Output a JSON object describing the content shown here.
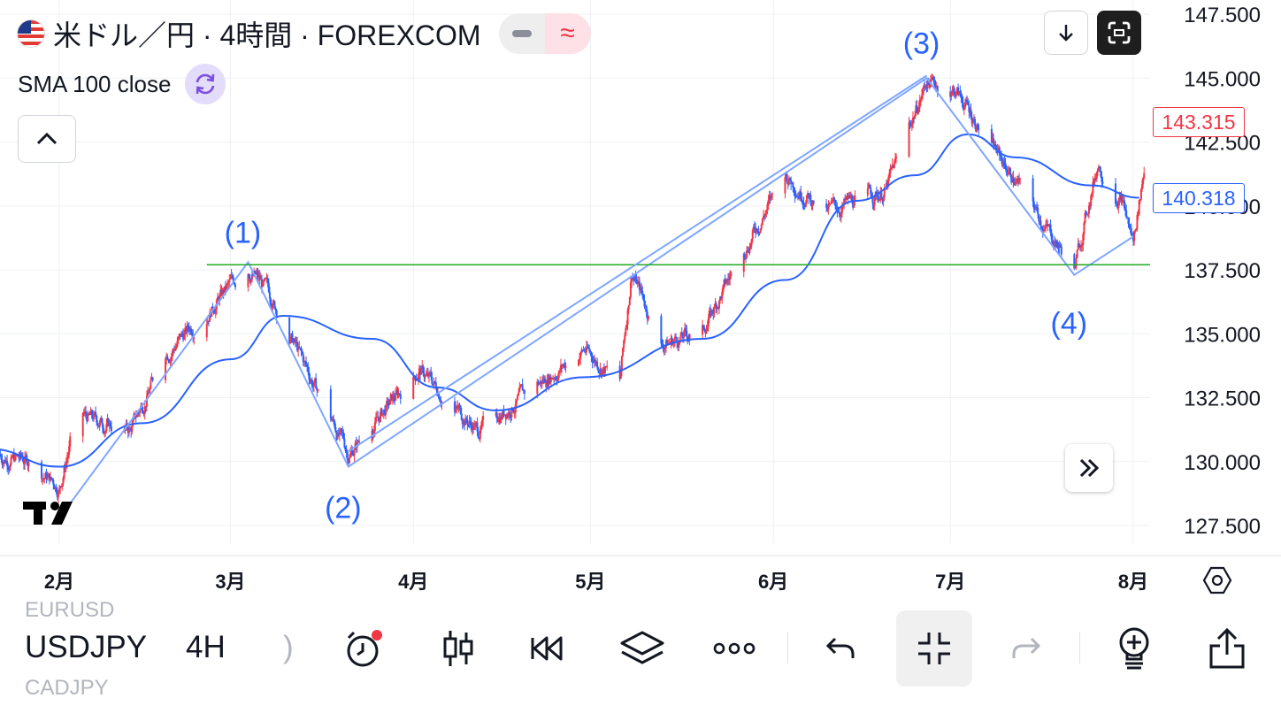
{
  "header": {
    "symbol_title": "米ドル／円 · 4時間 · FOREXCOM",
    "indicator_label": "SMA 100 close"
  },
  "price_tags": {
    "last_price": "143.315",
    "sma_value": "140.318"
  },
  "colors": {
    "up": "#f23645",
    "down": "#2962ff",
    "sma": "#2962ff",
    "trendline": "#7fa6ff",
    "level": "#22ab22",
    "wave_label": "#2962ff",
    "grid": "#eef0f3"
  },
  "icons": {
    "flag": "us-japan-flag-icon",
    "minus": "minus-icon",
    "approx": "approx-icon",
    "sync": "sync-icon",
    "collapse": "chevron-up-icon",
    "down": "arrow-down-icon",
    "fullscreen": "fullscreen-icon",
    "forward": "double-chevron-right-icon",
    "settings": "settings-hexagon-icon"
  },
  "approx_glyph": "≈",
  "chart_data": {
    "type": "candlestick",
    "y_ticks": [
      "147.500",
      "145.000",
      "142.500",
      "140.000",
      "137.500",
      "135.000",
      "132.500",
      "130.000",
      "127.500"
    ],
    "x_ticks": [
      "2月",
      "3月",
      "4月",
      "5月",
      "6月",
      "7月",
      "8月"
    ],
    "ylim": [
      126.5,
      147.9
    ],
    "wave_labels": [
      "(1)",
      "(2)",
      "(3)",
      "(4)"
    ],
    "pivots": [
      {
        "x": "2024-02-02",
        "y": 128.1
      },
      {
        "x": "2024-03-04",
        "y": 137.8
      },
      {
        "x": "2024-03-21",
        "y": 129.8
      },
      {
        "x": "2024-06-27",
        "y": 145.0
      },
      {
        "x": "2024-07-22",
        "y": 137.3
      },
      {
        "x": "2024-08-01",
        "y": 138.8
      }
    ],
    "horizontal_level": 137.7,
    "sma_path": [
      {
        "x": "2024-01-20",
        "y": 130.5
      },
      {
        "x": "2024-02-01",
        "y": 129.8
      },
      {
        "x": "2024-02-15",
        "y": 131.5
      },
      {
        "x": "2024-03-01",
        "y": 134.0
      },
      {
        "x": "2024-03-10",
        "y": 135.7
      },
      {
        "x": "2024-03-25",
        "y": 134.8
      },
      {
        "x": "2024-04-05",
        "y": 132.9
      },
      {
        "x": "2024-04-15",
        "y": 132.0
      },
      {
        "x": "2024-04-30",
        "y": 133.3
      },
      {
        "x": "2024-05-20",
        "y": 134.8
      },
      {
        "x": "2024-06-03",
        "y": 137.1
      },
      {
        "x": "2024-06-15",
        "y": 140.2
      },
      {
        "x": "2024-06-25",
        "y": 141.2
      },
      {
        "x": "2024-07-04",
        "y": 142.8
      },
      {
        "x": "2024-07-12",
        "y": 141.9
      },
      {
        "x": "2024-07-25",
        "y": 140.8
      },
      {
        "x": "2024-08-02",
        "y": 140.32
      }
    ],
    "price_path": [
      {
        "x": "2024-01-20",
        "y": 130.3
      },
      {
        "x": "2024-01-27",
        "y": 130.0
      },
      {
        "x": "2024-02-01",
        "y": 129.0
      },
      {
        "x": "2024-02-04",
        "y": 131.8
      },
      {
        "x": "2024-02-13",
        "y": 131.2
      },
      {
        "x": "2024-02-19",
        "y": 134.2
      },
      {
        "x": "2024-03-04",
        "y": 137.6
      },
      {
        "x": "2024-03-08",
        "y": 136.4
      },
      {
        "x": "2024-03-21",
        "y": 130.3
      },
      {
        "x": "2024-04-02",
        "y": 133.6
      },
      {
        "x": "2024-04-12",
        "y": 131.2
      },
      {
        "x": "2024-04-30",
        "y": 134.4
      },
      {
        "x": "2024-05-06",
        "y": 133.1
      },
      {
        "x": "2024-05-08",
        "y": 137.5
      },
      {
        "x": "2024-05-13",
        "y": 134.6
      },
      {
        "x": "2024-05-20",
        "y": 135.1
      },
      {
        "x": "2024-05-28",
        "y": 138.7
      },
      {
        "x": "2024-06-03",
        "y": 141.2
      },
      {
        "x": "2024-06-10",
        "y": 139.8
      },
      {
        "x": "2024-06-20",
        "y": 140.6
      },
      {
        "x": "2024-06-27",
        "y": 144.9
      },
      {
        "x": "2024-07-02",
        "y": 144.5
      },
      {
        "x": "2024-07-12",
        "y": 141.0
      },
      {
        "x": "2024-07-22",
        "y": 137.5
      },
      {
        "x": "2024-07-26",
        "y": 141.7
      },
      {
        "x": "2024-07-30",
        "y": 140.3
      },
      {
        "x": "2024-08-01",
        "y": 138.6
      },
      {
        "x": "2024-08-04",
        "y": 143.3
      }
    ]
  },
  "toolbar": {
    "prev_symbol": "EURUSD",
    "symbol": "USDJPY",
    "timeframe": "4H",
    "next_symbol_hint": ")",
    "next_symbol": "CADJPY",
    "buttons": [
      "alarm-clock-icon",
      "candles-icon",
      "replay-icon",
      "layers-icon",
      "more-icon",
      "undo-icon",
      "collapse-icon",
      "redo-icon",
      "add-indicator-icon",
      "share-icon"
    ]
  }
}
